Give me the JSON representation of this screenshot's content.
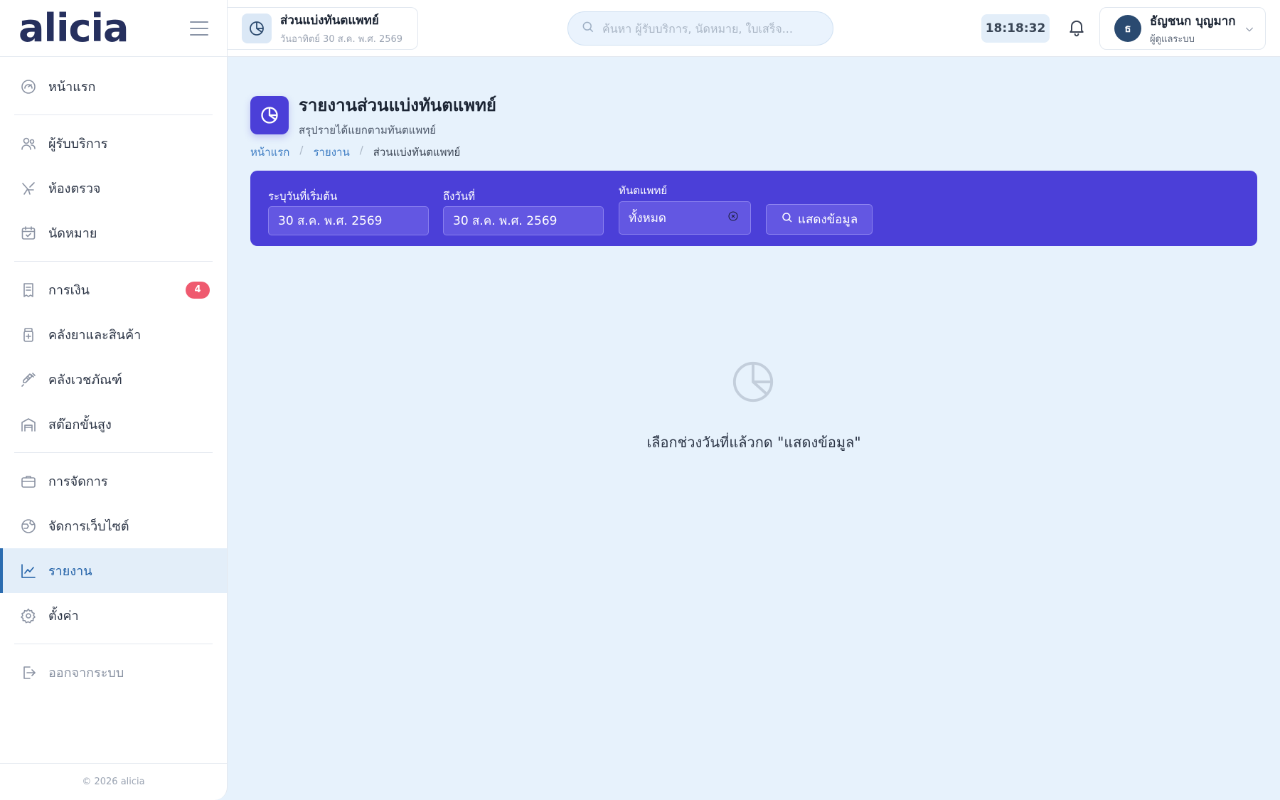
{
  "app": {
    "logo": "alicia"
  },
  "sidebar": {
    "items": [
      {
        "id": "home",
        "label": "หน้าแรก",
        "icon": "gauge-icon"
      },
      {
        "id": "clients",
        "label": "ผู้รับบริการ",
        "icon": "users-icon"
      },
      {
        "id": "exam-room",
        "label": "ห้องตรวจ",
        "icon": "dental-chair-icon"
      },
      {
        "id": "appointments",
        "label": "นัดหมาย",
        "icon": "calendar-check-icon"
      },
      {
        "id": "finance",
        "label": "การเงิน",
        "icon": "receipt-icon",
        "badge": "4"
      },
      {
        "id": "pharmacy",
        "label": "คลังยาและสินค้า",
        "icon": "medicine-bottle-icon"
      },
      {
        "id": "medical-supplies",
        "label": "คลังเวชภัณฑ์",
        "icon": "syringe-icon"
      },
      {
        "id": "advanced-stock",
        "label": "สต๊อกขั้นสูง",
        "icon": "warehouse-icon"
      },
      {
        "id": "management",
        "label": "การจัดการ",
        "icon": "briefcase-icon"
      },
      {
        "id": "website",
        "label": "จัดการเว็บไซต์",
        "icon": "globe-icon"
      },
      {
        "id": "reports",
        "label": "รายงาน",
        "icon": "trend-chart-icon",
        "active": true
      },
      {
        "id": "settings",
        "label": "ตั้งค่า",
        "icon": "gear-icon"
      },
      {
        "id": "logout",
        "label": "ออกจากระบบ",
        "icon": "logout-icon"
      }
    ],
    "footer": "© 2026 alicia"
  },
  "topbar": {
    "page_chip": {
      "title": "ส่วนแบ่งทันตแพทย์",
      "subtitle": "วันอาทิตย์ 30 ส.ค. พ.ศ. 2569",
      "icon": "pie-chart-icon"
    },
    "search": {
      "placeholder": "ค้นหา ผู้รับบริการ, นัดหมาย, ใบเสร็จ...",
      "value": ""
    },
    "clock": "18:18:32",
    "user": {
      "initial": "ธ",
      "name": "ธัญชนก บุญมาก",
      "role": "ผู้ดูแลระบบ"
    }
  },
  "page": {
    "title": "รายงานส่วนแบ่งทันตแพทย์",
    "subtitle": "สรุปรายได้แยกตามทันตแพทย์",
    "breadcrumb": {
      "home": "หน้าแรก",
      "reports": "รายงาน",
      "current": "ส่วนแบ่งทันตแพทย์"
    }
  },
  "filters": {
    "start_label": "ระบุวันที่เริ่มต้น",
    "start_value": "30 ส.ค. พ.ศ. 2569",
    "end_label": "ถึงวันที่",
    "end_value": "30 ส.ค. พ.ศ. 2569",
    "dentist_label": "ทันตแพทย์",
    "dentist_value": "ทั้งหมด",
    "show_button": "แสดงข้อมูล"
  },
  "empty_state": {
    "message": "เลือกช่วงวันที่แล้วกด \"แสดงข้อมูล\""
  },
  "colors": {
    "accent": "#4b3fd8",
    "active_nav": "#1f5fa6",
    "badge": "#ef5a6f",
    "background": "#e7f2fc"
  }
}
